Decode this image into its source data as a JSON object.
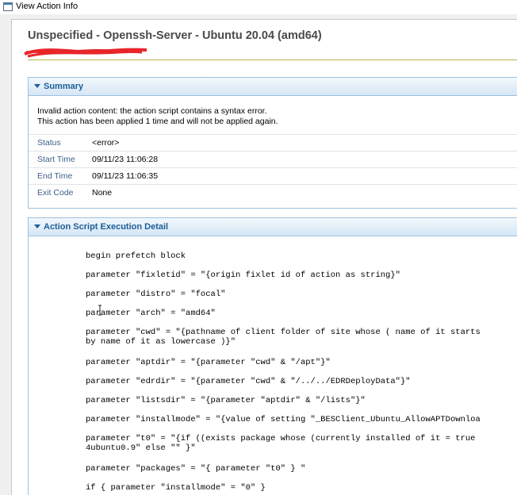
{
  "window": {
    "title": "View Action Info"
  },
  "heading": "Unspecified - Openssh-Server - Ubuntu 20.04 (amd64)",
  "summary": {
    "header": "Summary",
    "message_line1": "Invalid action content: the action script contains a syntax error.",
    "message_line2": "This action has been applied 1 time and will not be applied again.",
    "rows": [
      {
        "label": "Status",
        "value": "<error>"
      },
      {
        "label": "Start Time",
        "value": "09/11/23 11:06:28"
      },
      {
        "label": "End Time",
        "value": "09/11/23 11:06:35"
      },
      {
        "label": "Exit Code",
        "value": "None"
      }
    ]
  },
  "detail": {
    "header": "Action Script Execution Detail",
    "lines": [
      "begin prefetch block",
      "parameter \"fixletid\" = \"{origin fixlet id of action as string}\"",
      "parameter \"distro\" = \"focal\"",
      "parameter \"arch\" = \"amd64\"",
      "parameter \"cwd\" = \"{pathname of client folder of site whose ( name of it starts",
      "by name of it as lowercase )}\"",
      "parameter \"aptdir\" = \"{parameter \"cwd\" & \"/apt\"}\"",
      "parameter \"edrdir\" = \"{parameter \"cwd\" & \"/../../EDRDeployData\"}\"",
      "parameter \"listsdir\" = \"{parameter \"aptdir\" & \"/lists\"}\"",
      "parameter \"installmode\" = \"{value of setting \"_BESClient_Ubuntu_AllowAPTDownloa",
      "parameter \"t0\" = \"{if ((exists package whose (currently installed of it = true",
      "4ubuntu0.9\" else \"\" }\"",
      "parameter \"packages\" = \"{ parameter \"t0\" } \"",
      "if { parameter \"installmode\" = \"0\" }"
    ]
  },
  "colors": {
    "accent": "#1f5e96",
    "panel_border": "#9cc0e0",
    "redaction": "#e8262a"
  },
  "icons": {
    "window": "window-app-icon",
    "panel_toggle": "chevron-down-icon",
    "cursor": "text-cursor-icon"
  }
}
